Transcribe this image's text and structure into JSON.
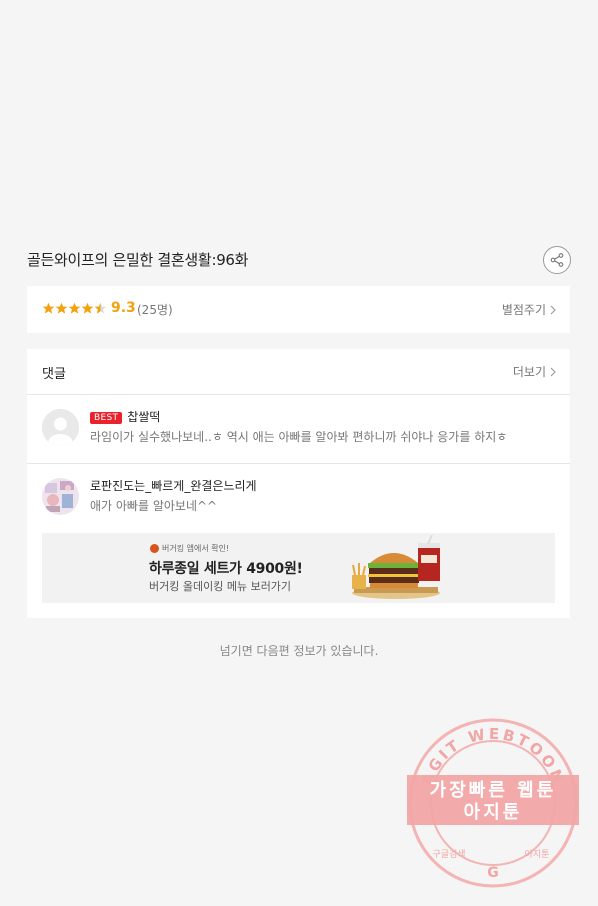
{
  "episode": {
    "title": "골든와이프의 은밀한 결혼생활:96화"
  },
  "rating": {
    "score": "9.3",
    "voters": "(25명)",
    "rate_label": "별점주기",
    "star_level": 4.5,
    "star_color": "#f2a20e"
  },
  "comments": {
    "title": "댓글",
    "more_label": "더보기",
    "items": [
      {
        "badge": "BEST",
        "author": "찹쌀떡",
        "text": "라임이가 실수했나보네..ㅎ 역시 애는 아빠를 알아봐 편하니까 쉬야나 응가를 하지ㅎ"
      },
      {
        "author": "로판진도는_빠르게_완결은느리게",
        "text": "애가 아빠를  알아보네^^"
      }
    ]
  },
  "ad": {
    "small_text": "버거킹 앱에서 확인!",
    "headline": "하루종일 세트가 4900원!",
    "subtext": "버거킹 올데이킹 메뉴 보러가기"
  },
  "notice": "넘기면 다음편 정보가 있습니다.",
  "watermark": {
    "arc_text": "AGIT WEBTOON",
    "line1": "가장빠른 웹툰",
    "line2": "아지툰",
    "left_small": "구글검색",
    "right_small": "아지툰",
    "center_letter": "G",
    "color": "#f2a5a5"
  }
}
